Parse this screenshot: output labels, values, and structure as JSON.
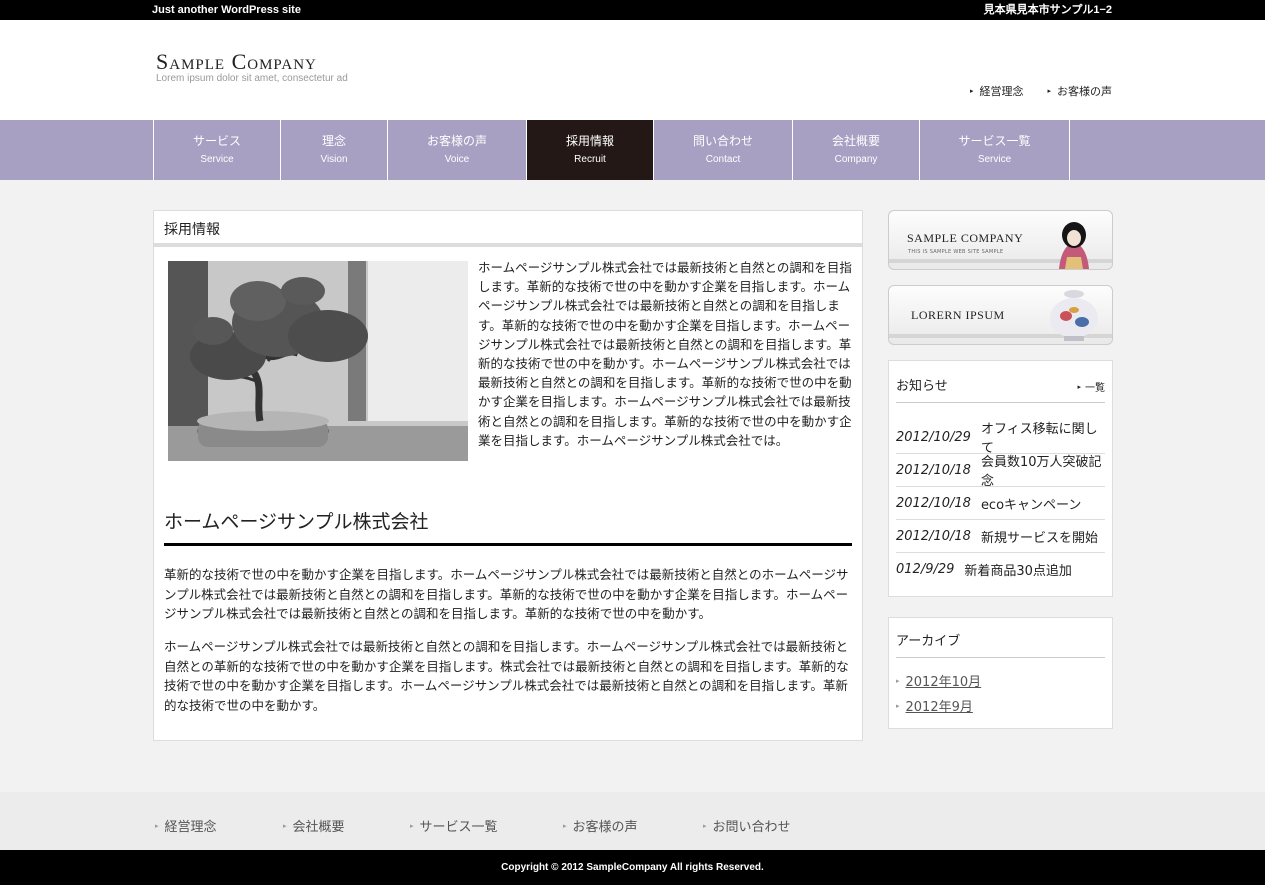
{
  "topbar": {
    "tagline": "Just another WordPress site",
    "address": "見本県見本市サンプル1−2"
  },
  "header": {
    "logo_name": "Sample Company",
    "logo_tag": "Lorem ipsum dolor sit amet, consectetur ad",
    "links": [
      "経営理念",
      "お客様の声"
    ]
  },
  "gnav": [
    {
      "jp": "サービス",
      "en": "Service"
    },
    {
      "jp": "理念",
      "en": "Vision"
    },
    {
      "jp": "お客様の声",
      "en": "Voice"
    },
    {
      "jp": "採用情報",
      "en": "Recruit"
    },
    {
      "jp": "問い合わせ",
      "en": "Contact"
    },
    {
      "jp": "会社概要",
      "en": "Company"
    },
    {
      "jp": "サービス一覧",
      "en": "Service"
    }
  ],
  "main": {
    "page_title": "採用情報",
    "intro": "ホームページサンプル株式会社では最新技術と自然との調和を目指します。革新的な技術で世の中を動かす企業を目指します。ホームページサンプル株式会社では最新技術と自然との調和を目指します。革新的な技術で世の中を動かす企業を目指します。ホームページサンプル株式会社では最新技術と自然との調和を目指します。革新的な技術で世の中を動かす。ホームページサンプル株式会社では最新技術と自然との調和を目指します。革新的な技術で世の中を動かす企業を目指します。ホームページサンプル株式会社では最新技術と自然との調和を目指します。革新的な技術で世の中を動かす企業を目指します。ホームページサンプル株式会社では。",
    "heading": "ホームページサンプル株式会社",
    "para1": "革新的な技術で世の中を動かす企業を目指します。ホームページサンプル株式会社では最新技術と自然とのホームページサンプル株式会社では最新技術と自然との調和を目指します。革新的な技術で世の中を動かす企業を目指します。ホームページサンプル株式会社では最新技術と自然との調和を目指します。革新的な技術で世の中を動かす。",
    "para2": "ホームページサンプル株式会社では最新技術と自然との調和を目指します。ホームページサンプル株式会社では最新技術と自然との革新的な技術で世の中を動かす企業を目指します。株式会社では最新技術と自然との調和を目指します。革新的な技術で世の中を動かす企業を目指します。ホームページサンプル株式会社では最新技術と自然との調和を目指します。革新的な技術で世の中を動かす。"
  },
  "sidebar": {
    "banner1": {
      "title": "SAMPLE COMPANY",
      "sub": "THIS IS SAMPLE WEB SITE SAMPLE"
    },
    "banner2": {
      "title": "LORERN IPSUM"
    },
    "news": {
      "title": "お知らせ",
      "more": "一覧",
      "items": [
        {
          "date": "2012/10/29",
          "text": "オフィス移転に関して"
        },
        {
          "date": "2012/10/18",
          "text": "会員数10万人突破記念"
        },
        {
          "date": "2012/10/18",
          "text": "ecoキャンペーン"
        },
        {
          "date": "2012/10/18",
          "text": "新規サービスを開始"
        },
        {
          "date": "012/9/29",
          "text": "新着商品30点追加"
        }
      ]
    },
    "archive": {
      "title": "アーカイブ",
      "items": [
        "2012年10月",
        "2012年9月"
      ]
    }
  },
  "footer": {
    "links": [
      "経営理念",
      "会社概要",
      "サービス一覧",
      "お客様の声",
      "お問い合わせ"
    ],
    "copyright": "Copyright © 2012 SampleCompany All rights Reserved."
  },
  "colors": {
    "nav_bg": "#a7a0c2",
    "nav_active": "#231815"
  },
  "icons": {
    "link_marker": "chevron-right-icon"
  }
}
